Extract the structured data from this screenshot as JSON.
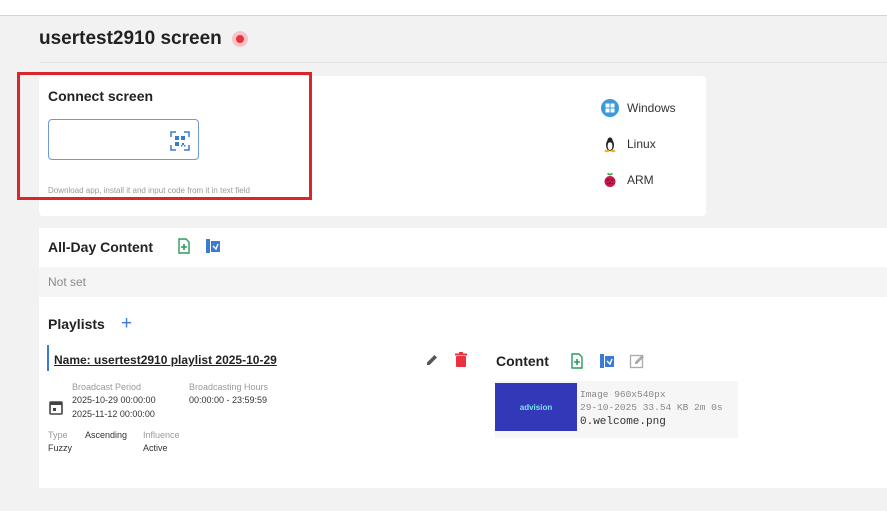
{
  "page": {
    "title": "usertest2910 screen",
    "status_color": "#e8323f"
  },
  "connect": {
    "title": "Connect screen",
    "code_value": "",
    "hint": "Download app, install it and input code from it in text field",
    "qr_icon": "qr-code-icon"
  },
  "platforms": [
    {
      "label": "Windows",
      "icon": "windows-icon",
      "color": "#3a9ad9"
    },
    {
      "label": "Linux",
      "icon": "linux-icon",
      "color": "#222222"
    },
    {
      "label": "ARM",
      "icon": "raspberry-pi-icon",
      "color": "#c51a4a"
    }
  ],
  "all_day": {
    "title": "All-Day Content",
    "value": "Not set",
    "add_icon": "add-file-icon",
    "library_icon": "media-library-icon"
  },
  "playlists": {
    "title": "Playlists",
    "add_label": "+",
    "item": {
      "name": "Name: usertest2910 playlist 2025-10-29",
      "broadcast_period_label": "Broadcast Period",
      "period_start": "2025-10-29 00:00:00",
      "period_end": "2025-11-12 00:00:00",
      "hours_label": "Broadcasting Hours",
      "hours_value": "00:00:00 - 23:59:59",
      "type_label": "Type",
      "type_value": "Ascending",
      "type_value2": "Fuzzy",
      "influence_label": "Influence",
      "influence_value": "Active"
    }
  },
  "content": {
    "title": "Content",
    "file": {
      "logo": "advision",
      "meta1": "Image 960x540px",
      "meta2": "29-10-2025  33.54 KB  2m 0s",
      "name": "0.welcome.png"
    }
  },
  "colors": {
    "accent": "#3a7bd5",
    "green": "#2e9a5c",
    "danger": "#e8323f",
    "highlight_box": "#d9262c"
  }
}
